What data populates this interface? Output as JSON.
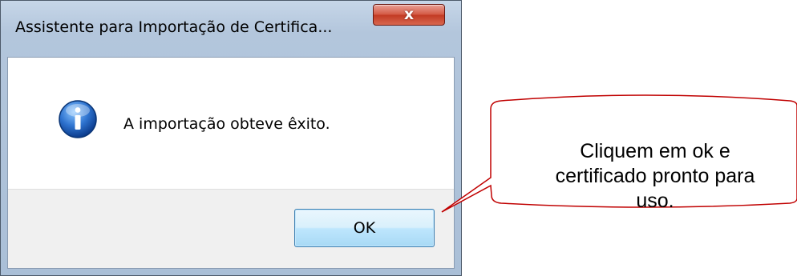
{
  "window": {
    "title": "Assistente para Importação de Certifica...",
    "close_glyph": "x"
  },
  "message": {
    "icon": "info-icon",
    "text": "A importação obteve êxito."
  },
  "buttons": {
    "ok_label": "OK"
  },
  "callout": {
    "line1": "Cliquem em ok e",
    "line2": "certificado pronto para",
    "line3": "uso."
  },
  "colors": {
    "callout_border": "#c00000",
    "ok_border": "#3c7fb1",
    "close_button": "#c23a23",
    "titlebar": "#b3c6dc"
  }
}
